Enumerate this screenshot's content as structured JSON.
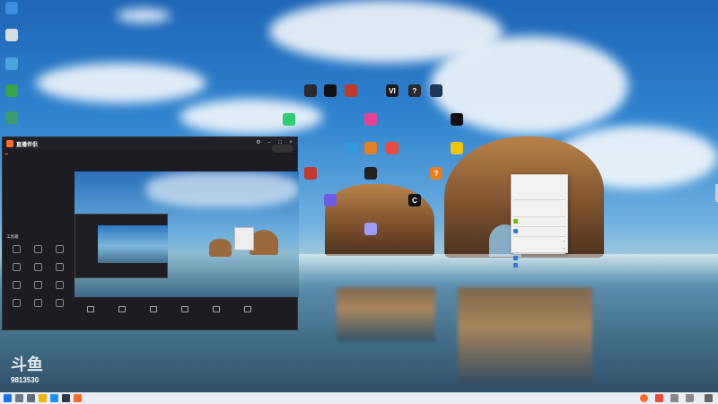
{
  "desktop": {
    "icons": [
      {
        "id": "left-1",
        "glyph": "",
        "label": "",
        "color": "#3a8de0"
      },
      {
        "id": "left-2",
        "glyph": "",
        "label": "",
        "color": "#d8dde3"
      },
      {
        "id": "left-3",
        "glyph": "",
        "label": "",
        "color": "#4aa3e0"
      },
      {
        "id": "left-4",
        "glyph": "",
        "label": "",
        "color": "#37a34a"
      },
      {
        "id": "left-5",
        "glyph": "",
        "label": "",
        "color": "#3a9b6b"
      },
      {
        "id": "g1",
        "glyph": "",
        "label": "",
        "color": "#2a2a2a"
      },
      {
        "id": "g2",
        "glyph": "",
        "label": "",
        "color": "#111111"
      },
      {
        "id": "g3",
        "glyph": "",
        "label": "",
        "color": "#c0392b"
      },
      {
        "id": "g4",
        "glyph": "VI",
        "label": "",
        "color": "#1a1a1a"
      },
      {
        "id": "g5",
        "glyph": "?",
        "label": "",
        "color": "#2a2a2a"
      },
      {
        "id": "g6",
        "glyph": "",
        "label": "",
        "color": "#1b3a5a"
      },
      {
        "id": "g7",
        "glyph": "",
        "label": "",
        "color": "#2ecc71"
      },
      {
        "id": "g8",
        "glyph": "",
        "label": "",
        "color": "#e84393"
      },
      {
        "id": "g9",
        "glyph": "",
        "label": "",
        "color": "#111111"
      },
      {
        "id": "g10",
        "glyph": "",
        "label": "",
        "color": "#e67e22"
      },
      {
        "id": "g11",
        "glyph": "",
        "label": "",
        "color": "#3498db"
      },
      {
        "id": "g12",
        "glyph": "",
        "label": "",
        "color": "#e74c3c"
      },
      {
        "id": "g13",
        "glyph": "",
        "label": "",
        "color": "#f1c40f"
      },
      {
        "id": "g14",
        "glyph": "",
        "label": "",
        "color": "#222222"
      },
      {
        "id": "g15",
        "glyph": "?",
        "label": "",
        "color": "#e67e22"
      },
      {
        "id": "g16",
        "glyph": "",
        "label": "",
        "color": "#c0392b"
      },
      {
        "id": "g17",
        "glyph": "",
        "label": "",
        "color": "#6c5ce7"
      },
      {
        "id": "g18",
        "glyph": "C",
        "label": "",
        "color": "#111111"
      },
      {
        "id": "g19",
        "glyph": "",
        "label": "",
        "color": "#a29bfe"
      }
    ]
  },
  "context_menu": {
    "items": [
      {
        "label": "",
        "type": "item"
      },
      {
        "label": "",
        "type": "item"
      },
      {
        "label": "",
        "type": "item"
      },
      {
        "type": "sep"
      },
      {
        "label": "",
        "type": "disabled"
      },
      {
        "label": "",
        "type": "disabled"
      },
      {
        "type": "sep"
      },
      {
        "label": "",
        "type": "icon",
        "icon_color": "#76b900"
      },
      {
        "type": "sep"
      },
      {
        "label": "",
        "type": "icon",
        "icon_color": "#2b7bd8"
      },
      {
        "type": "sep"
      },
      {
        "label": "",
        "type": "submenu"
      },
      {
        "label": "",
        "type": "submenu"
      },
      {
        "type": "sep"
      },
      {
        "label": "",
        "type": "icon",
        "icon_color": "#2b7bd8"
      },
      {
        "label": "",
        "type": "icon",
        "icon_color": "#2b7bd8"
      }
    ]
  },
  "app": {
    "title": "直播伴侣",
    "version": "",
    "tabs": [
      "",
      "",
      "",
      ""
    ],
    "scene_label": "",
    "record_label": "",
    "tools_title": "工具箱",
    "tools": [
      "",
      "",
      "",
      "",
      "",
      "",
      "",
      "",
      "",
      "",
      "",
      ""
    ],
    "bottom_actions": [
      "",
      "",
      "",
      "",
      "",
      ""
    ],
    "golive_label": "",
    "status_text": ""
  },
  "watermark": {
    "logo": "斗鱼",
    "sub": "",
    "room": "9813530"
  },
  "taskbar": {
    "time": "",
    "date": ""
  },
  "colors": {
    "accent": "#ff6a2b",
    "app_bg": "#1c1c22"
  }
}
